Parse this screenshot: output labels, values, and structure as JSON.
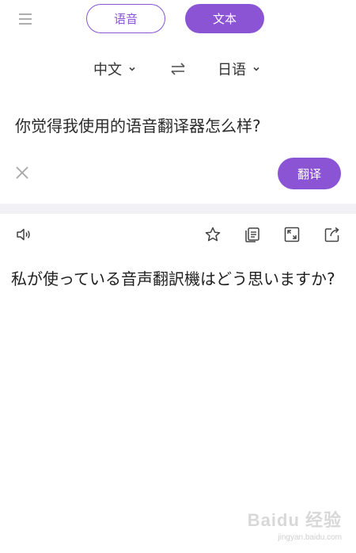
{
  "top_bar": {
    "menu_icon": "hamburger-menu-icon",
    "mode_voice_label": "语音",
    "mode_text_label": "文本",
    "accent_color": "#8b54d4"
  },
  "languages": {
    "source": "中文",
    "target": "日语",
    "swap_icon": "swap-arrows-icon"
  },
  "input": {
    "text": "你觉得我使用的语音翻译器怎么样?",
    "clear_icon": "close-icon",
    "translate_label": "翻译"
  },
  "output": {
    "toolbar_icons": [
      "speaker-icon",
      "star-icon",
      "copy-icon",
      "expand-icon",
      "share-icon"
    ],
    "text": "私が使っている音声翻訳機はどう思いますか?"
  },
  "watermark": {
    "brand": "Baidu 经验",
    "sub": "jingyan.baidu.com"
  }
}
